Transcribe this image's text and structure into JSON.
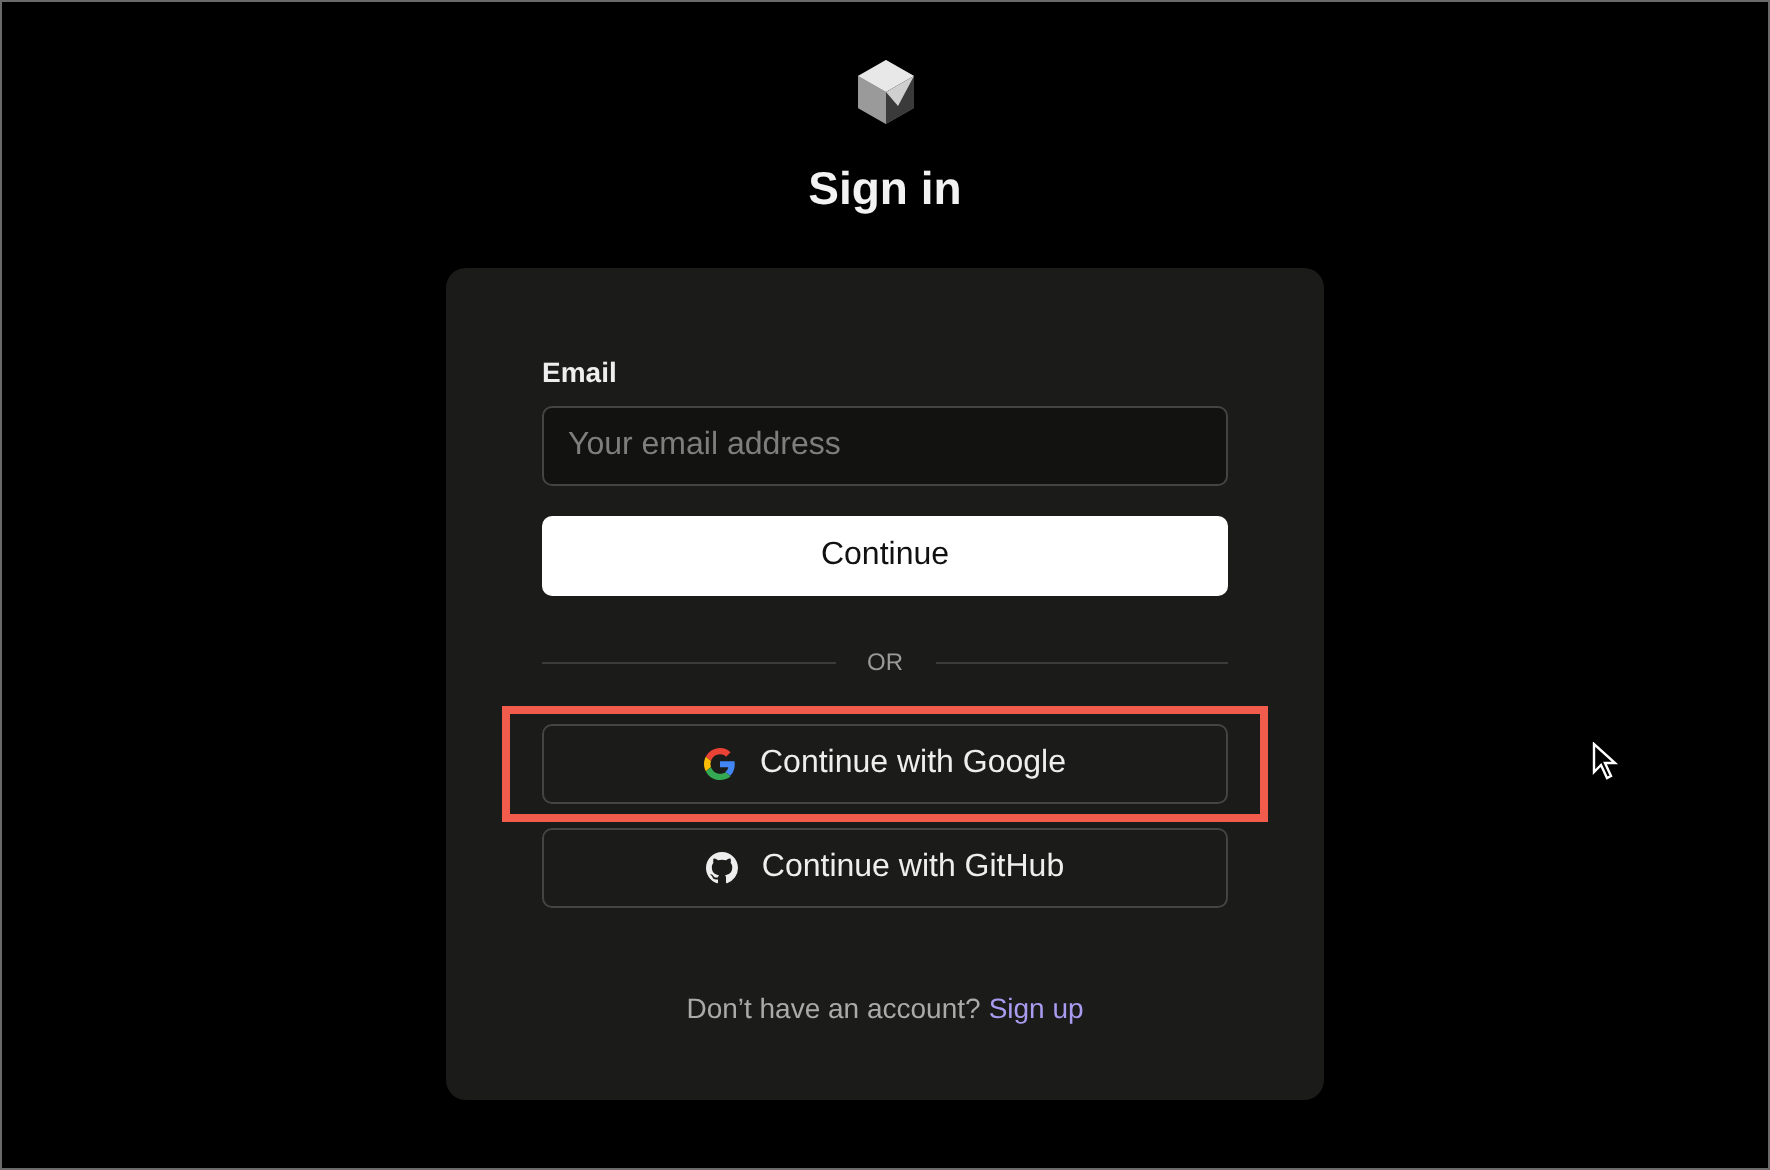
{
  "title": "Sign in",
  "form": {
    "email_label": "Email",
    "email_placeholder": "Your email address",
    "submit": "Continue",
    "divider": "OR"
  },
  "social_buttons": [
    {
      "kind": "google",
      "label": "Continue with Google",
      "highlighted": true
    },
    {
      "kind": "github",
      "label": "Continue with GitHub",
      "highlighted": false
    }
  ],
  "footer": {
    "text": "Don’t have an account?",
    "link": "Sign up"
  }
}
